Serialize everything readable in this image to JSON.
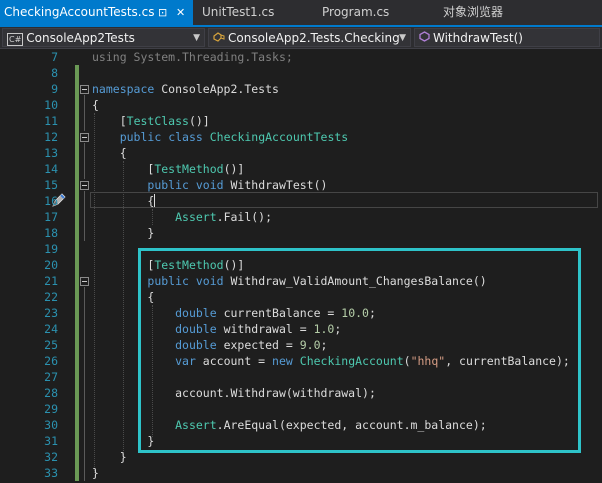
{
  "tabs": {
    "active_label": "CheckingAccountTests.cs",
    "pin_glyph": "⊡",
    "close_glyph": "✕",
    "others": [
      "UnitTest1.cs",
      "Program.cs",
      "对象浏览器"
    ]
  },
  "navbar": {
    "project": "ConsoleApp2Tests",
    "project_icon": "C#",
    "class_name": "ConsoleApp2.Tests.Checking",
    "member": "WithdrawTest()"
  },
  "editor": {
    "line_numbers": [
      "7",
      "8",
      "9",
      "10",
      "11",
      "12",
      "13",
      "14",
      "15",
      "16",
      "17",
      "18",
      "19",
      "20",
      "21",
      "22",
      "23",
      "24",
      "25",
      "26",
      "27",
      "28",
      "29",
      "30",
      "31",
      "32",
      "33"
    ],
    "code": {
      "l7_kw": "using",
      "l7_rest": " System.Threading.Tasks;",
      "l9_kw": "namespace",
      "l9_rest": " ConsoleApp2.Tests",
      "l10": "{",
      "l11_attr": "TestClass",
      "l11_open": "[",
      "l11_close": "()]",
      "l12_kw1": "public",
      "l12_kw2": "class",
      "l12_type": "CheckingAccountTests",
      "l13": "{",
      "l14_attr": "TestMethod",
      "l14_open": "[",
      "l14_close": "()]",
      "l15_kw1": "public",
      "l15_kw2": "void",
      "l15_rest": " WithdrawTest()",
      "l16": "{",
      "l17_type": "Assert",
      "l17_rest": ".Fail();",
      "l18": "}",
      "l20_attr": "TestMethod",
      "l20_open": "[",
      "l20_close": "()]",
      "l21_kw1": "public",
      "l21_kw2": "void",
      "l21_rest": " Withdraw_ValidAmount_ChangesBalance()",
      "l22": "{",
      "l23_kw": "double",
      "l23_rest": " currentBalance = ",
      "l23_num": "10.0",
      "l23_end": ";",
      "l24_kw": "double",
      "l24_rest": " withdrawal = ",
      "l24_num": "1.0",
      "l24_end": ";",
      "l25_kw": "double",
      "l25_rest": " expected = ",
      "l25_num": "9.0",
      "l25_end": ";",
      "l26_kw1": "var",
      "l26_mid": " account = ",
      "l26_kw2": "new",
      "l26_type": "CheckingAccount",
      "l26_paren": "(",
      "l26_str": "\"hhq\"",
      "l26_end": ", currentBalance);",
      "l28": "account.Withdraw(withdrawal);",
      "l30_type": "Assert",
      "l30_rest": ".AreEqual(expected, account.m_balance);",
      "l31": "}",
      "l32": "}",
      "l33": "}"
    }
  },
  "colors": {
    "accent": "#007acc",
    "highlight_box": "#2ec3c9",
    "keyword": "#569cd6",
    "type": "#4ec9b0",
    "string": "#d69d85",
    "number": "#b5cea8",
    "line_number": "#2b91af",
    "change_bar": "#6a9955"
  },
  "icons": {
    "pin": "pin-icon",
    "close": "close-icon",
    "csharp": "csharp-project-icon",
    "class": "class-icon",
    "method": "method-icon",
    "dropdown": "chevron-down-icon",
    "edit": "edit-pen-icon"
  }
}
